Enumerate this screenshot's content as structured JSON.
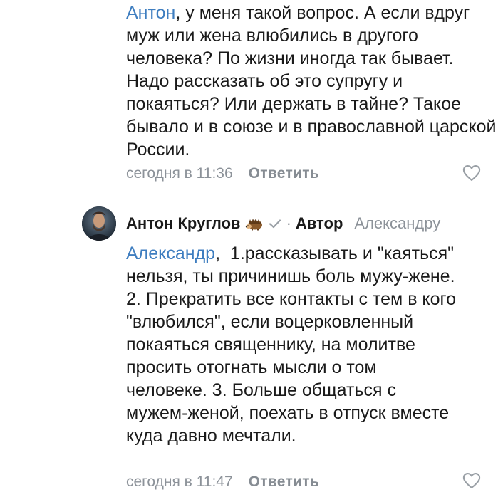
{
  "comment1": {
    "mention": "Антон",
    "text": ", у меня такой вопрос. А если вдруг муж или жена влюбились в другого человека? По жизни иногда так бывает. Надо рассказать об это супругу и покаяться? Или держать в тайне? Такое бывало и в союзе и в православной царской России.",
    "timestamp": "сегодня в 11:36",
    "reply_label": "Ответить",
    "like_icon": "heart-outline-icon"
  },
  "comment2": {
    "author": "Антон Круглов",
    "author_icon": "hedgehog-emoji",
    "verified_icon": "checkmark-icon",
    "separator": "·",
    "badge": "Автор",
    "reply_to": "Александру",
    "mention": "Александр",
    "text": ",  1.рассказывать и \"каяться\" нельзя, ты причинишь боль мужу-жене.  2. Прекратить все контакты с тем в кого \"влюбился\", если воцерковленный покаяться священнику, на молитве просить отогнать мысли о том человеке. 3. Больше общаться с мужем-женой, поехать в отпуск вместе куда давно мечтали.",
    "timestamp": "сегодня в 11:47",
    "reply_label": "Ответить",
    "like_icon": "heart-outline-icon"
  },
  "colors": {
    "link": "#3f7ec0",
    "muted": "#8c9299",
    "text": "#1a1a1a"
  }
}
